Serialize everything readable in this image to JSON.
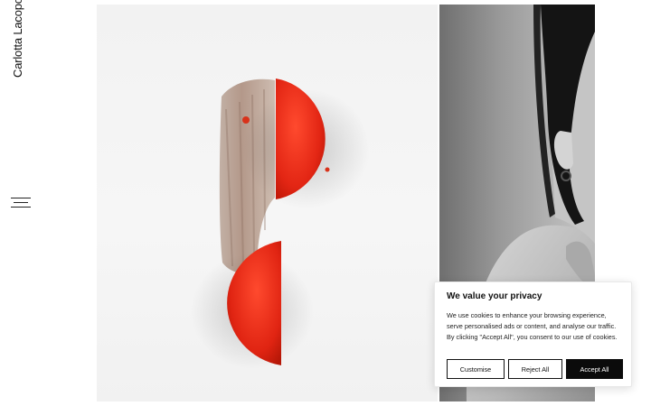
{
  "brand": {
    "name": "Carlotta Lacopo"
  },
  "menu": {
    "icon": "hamburger-menu-icon"
  },
  "gallery": {
    "items": [
      {
        "kind": "dessert-photo",
        "icon": "image"
      },
      {
        "kind": "portrait-photo",
        "icon": "image"
      }
    ]
  },
  "cookie_banner": {
    "title": "We value your privacy",
    "body": "We use cookies to enhance your browsing experience, serve personalised ads or content, and analyse our traffic. By clicking \"Accept All\", you consent to our use of cookies.",
    "buttons": {
      "customise": "Customise",
      "reject": "Reject All",
      "accept": "Accept All"
    }
  },
  "colors": {
    "accent": "#e32614",
    "text": "#111111",
    "button_dark": "#0b0b0b"
  }
}
